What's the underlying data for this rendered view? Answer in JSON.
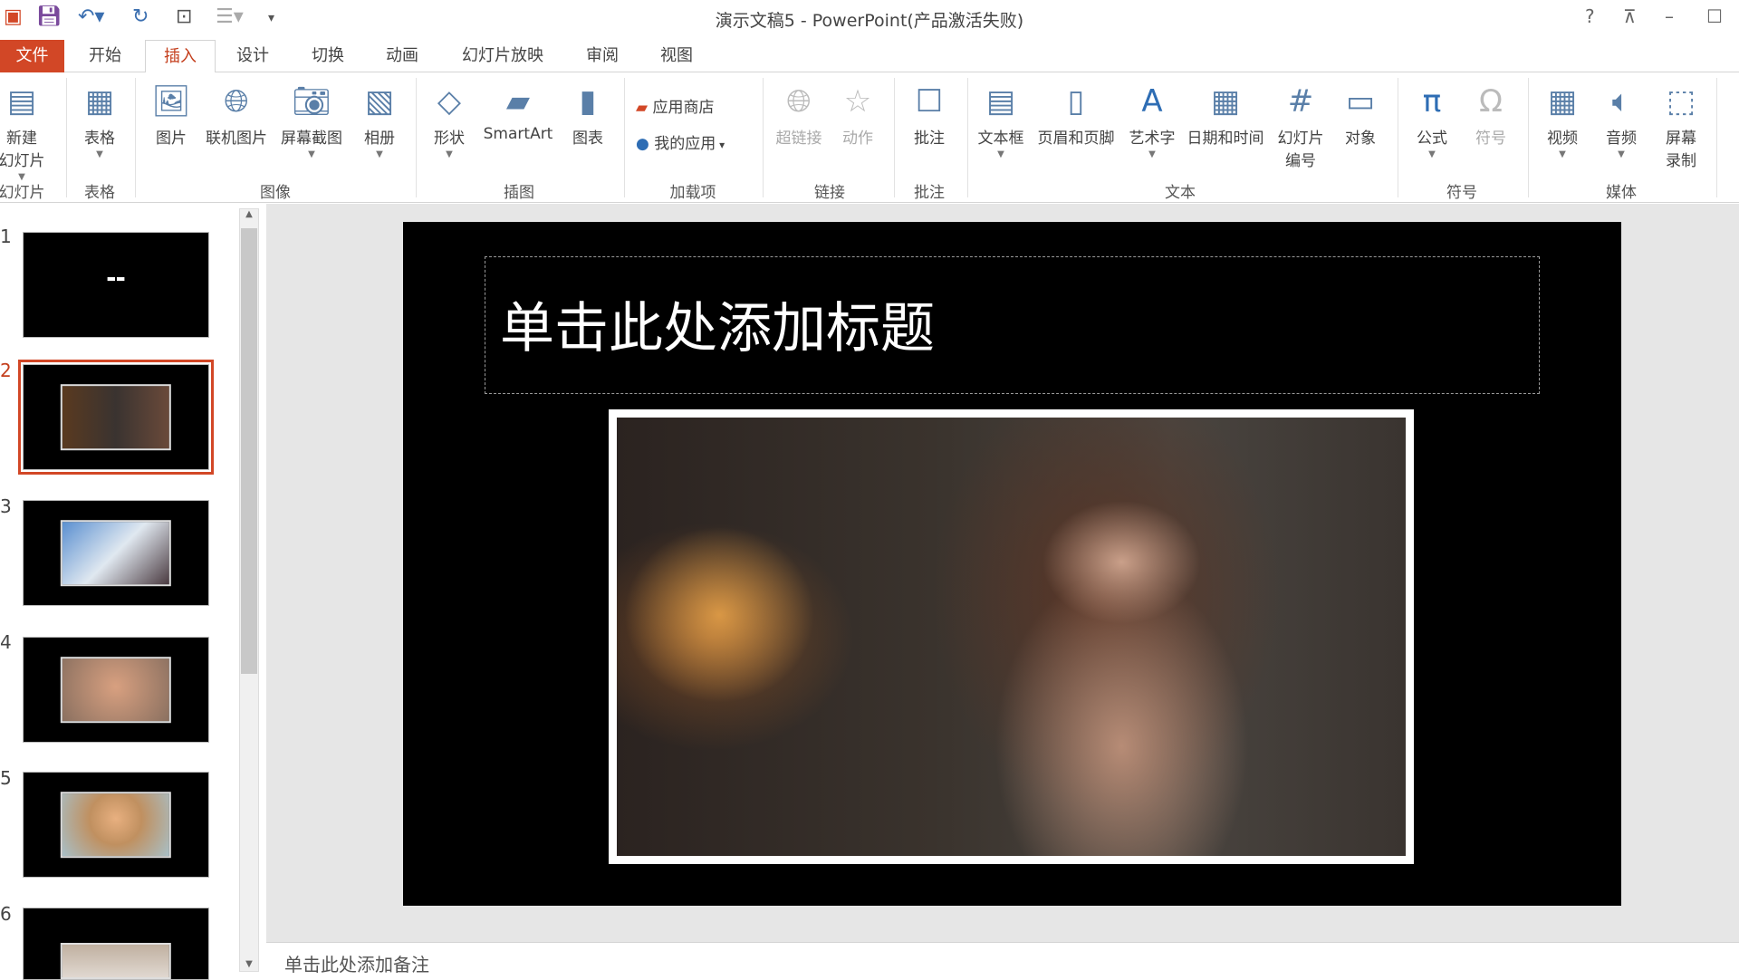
{
  "app": {
    "title": "演示文稿5 - PowerPoint(产品激活失败)",
    "window_controls": [
      "?",
      "restore-ribbon",
      "minimize",
      "maximize"
    ]
  },
  "tabs": [
    {
      "label": "文件"
    },
    {
      "label": "开始"
    },
    {
      "label": "插入",
      "active": true
    },
    {
      "label": "设计"
    },
    {
      "label": "切换"
    },
    {
      "label": "动画"
    },
    {
      "label": "幻灯片放映"
    },
    {
      "label": "审阅"
    },
    {
      "label": "视图"
    }
  ],
  "ribbon": {
    "buttons": [
      {
        "label": "新建\n幻灯片",
        "icon": "new-slide-icon"
      },
      {
        "label": "表格",
        "icon": "table-icon"
      },
      {
        "label": "图片",
        "icon": "picture-icon"
      },
      {
        "label": "联机图片",
        "icon": "online-picture-icon"
      },
      {
        "label": "屏幕截图",
        "icon": "screenshot-icon"
      },
      {
        "label": "相册",
        "icon": "album-icon"
      },
      {
        "label": "形状",
        "icon": "shapes-icon"
      },
      {
        "label": "SmartArt",
        "icon": "smartart-icon"
      },
      {
        "label": "图表",
        "icon": "chart-icon"
      },
      {
        "label": "超链接",
        "icon": "hyperlink-icon"
      },
      {
        "label": "动作",
        "icon": "action-icon"
      },
      {
        "label": "批注",
        "icon": "comment-icon"
      },
      {
        "label": "文本框",
        "icon": "textbox-icon"
      },
      {
        "label": "页眉和页脚",
        "icon": "header-footer-icon"
      },
      {
        "label": "艺术字",
        "icon": "wordart-icon"
      },
      {
        "label": "日期和时间",
        "icon": "date-time-icon"
      },
      {
        "label": "幻灯片\n编号",
        "icon": "slide-number-icon"
      },
      {
        "label": "对象",
        "icon": "object-icon"
      },
      {
        "label": "公式",
        "icon": "equation-icon"
      },
      {
        "label": "符号",
        "icon": "symbol-icon"
      },
      {
        "label": "视频",
        "icon": "video-icon"
      },
      {
        "label": "音频",
        "icon": "audio-icon"
      },
      {
        "label": "屏幕\n录制",
        "icon": "screen-recording-icon"
      }
    ],
    "store": "应用商店",
    "my_apps": "我的应用",
    "groups": [
      "幻灯片",
      "表格",
      "图像",
      "插图",
      "加载项",
      "链接",
      "批注",
      "文本",
      "符号",
      "媒体"
    ]
  },
  "slides": [
    {
      "number": "1"
    },
    {
      "number": "2",
      "selected": true
    },
    {
      "number": "3"
    },
    {
      "number": "4"
    },
    {
      "number": "5"
    },
    {
      "number": "6"
    }
  ],
  "slide": {
    "title_placeholder": "单击此处添加标题"
  },
  "notes": {
    "placeholder": "单击此处添加备注"
  },
  "colors": {
    "accent": "#d24726",
    "slide_bg": "#000000"
  }
}
